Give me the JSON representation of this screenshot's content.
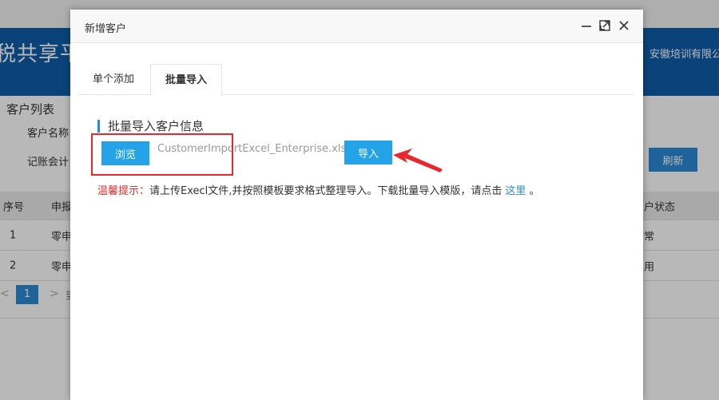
{
  "background": {
    "app_title": "税共享平",
    "company": "安徽培训有限公",
    "section_title": "客户列表",
    "filter_label_1": "客户名称",
    "filter_label_2": "记账会计",
    "refresh_label": "刷新",
    "table": {
      "headers": [
        "序号",
        "申报",
        "户状态"
      ],
      "rows": [
        {
          "index": "1",
          "col2": "零申",
          "status": "常"
        },
        {
          "index": "2",
          "col2": "零申",
          "status": "用"
        }
      ]
    },
    "pager": {
      "prev": "<",
      "current_page": "1",
      "next": ">",
      "text": "到"
    }
  },
  "dialog": {
    "title": "新增客户",
    "tabs": [
      {
        "label": "单个添加",
        "active": false
      },
      {
        "label": "批量导入",
        "active": true
      }
    ],
    "section_heading": "批量导入客户信息",
    "browse_label": "浏览",
    "file_name": "CustomerImportExcel_Enterprise.xls",
    "import_label": "导入",
    "hint_label": "温馨提示：",
    "hint_text": "请上传Execl文件,并按照模板要求格式整理导入。下载批量导入模版，请点击",
    "hint_link": "这里",
    "hint_end": "。"
  },
  "colors": {
    "header_blue": "#0d5ea8",
    "button_blue": "#24a3e9",
    "accent_blue": "#2a8ad6",
    "annotation_red": "#e8282e"
  }
}
